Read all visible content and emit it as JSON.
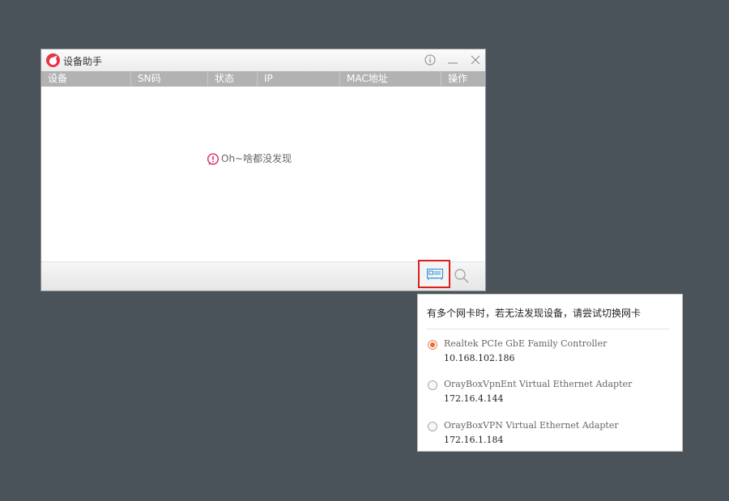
{
  "window": {
    "title": "设备助手",
    "controls": {
      "info_icon": "info-icon",
      "minimize_icon": "minimize-icon",
      "close_icon": "close-icon"
    }
  },
  "table": {
    "columns": [
      "设备",
      "SN码",
      "状态",
      "IP",
      "MAC地址",
      "操作"
    ],
    "empty_message": "Oh~啥都没发现"
  },
  "toolbar": {
    "nic_button_icon": "network-card-icon",
    "search_button_icon": "search-icon"
  },
  "popup": {
    "title": "有多个网卡时，若无法发现设备，请尝试切换网卡",
    "adapters": [
      {
        "name": "Realtek PCIe GbE Family Controller",
        "ip": "10.168.102.186",
        "selected": true
      },
      {
        "name": "OrayBoxVpnEnt Virtual Ethernet Adapter",
        "ip": "172.16.4.144",
        "selected": false
      },
      {
        "name": "OrayBoxVPN Virtual Ethernet Adapter",
        "ip": "172.16.1.184",
        "selected": false
      }
    ]
  },
  "colors": {
    "background": "#4b535a",
    "header": "#b2b2b2",
    "accent_red": "#d9201f",
    "logo": "#e8334a",
    "radio_selected": "#f06a2a",
    "icon_blue": "#1e8fd8"
  }
}
